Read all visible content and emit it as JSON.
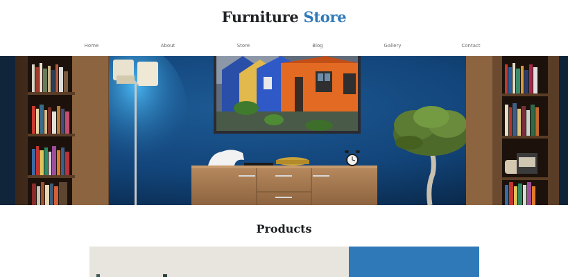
{
  "site": {
    "title_main": "Furniture",
    "title_accent": "Store",
    "accent_color": "#2f79b9"
  },
  "nav": {
    "items": [
      {
        "label": "Home"
      },
      {
        "label": "About"
      },
      {
        "label": "Store"
      },
      {
        "label": "Blog"
      },
      {
        "label": "Gallery"
      },
      {
        "label": "Contact"
      }
    ]
  },
  "hero": {
    "description": "",
    "wall_color": "#123e6d"
  },
  "products": {
    "heading": "Products",
    "panel_color": "#2f79b9"
  }
}
